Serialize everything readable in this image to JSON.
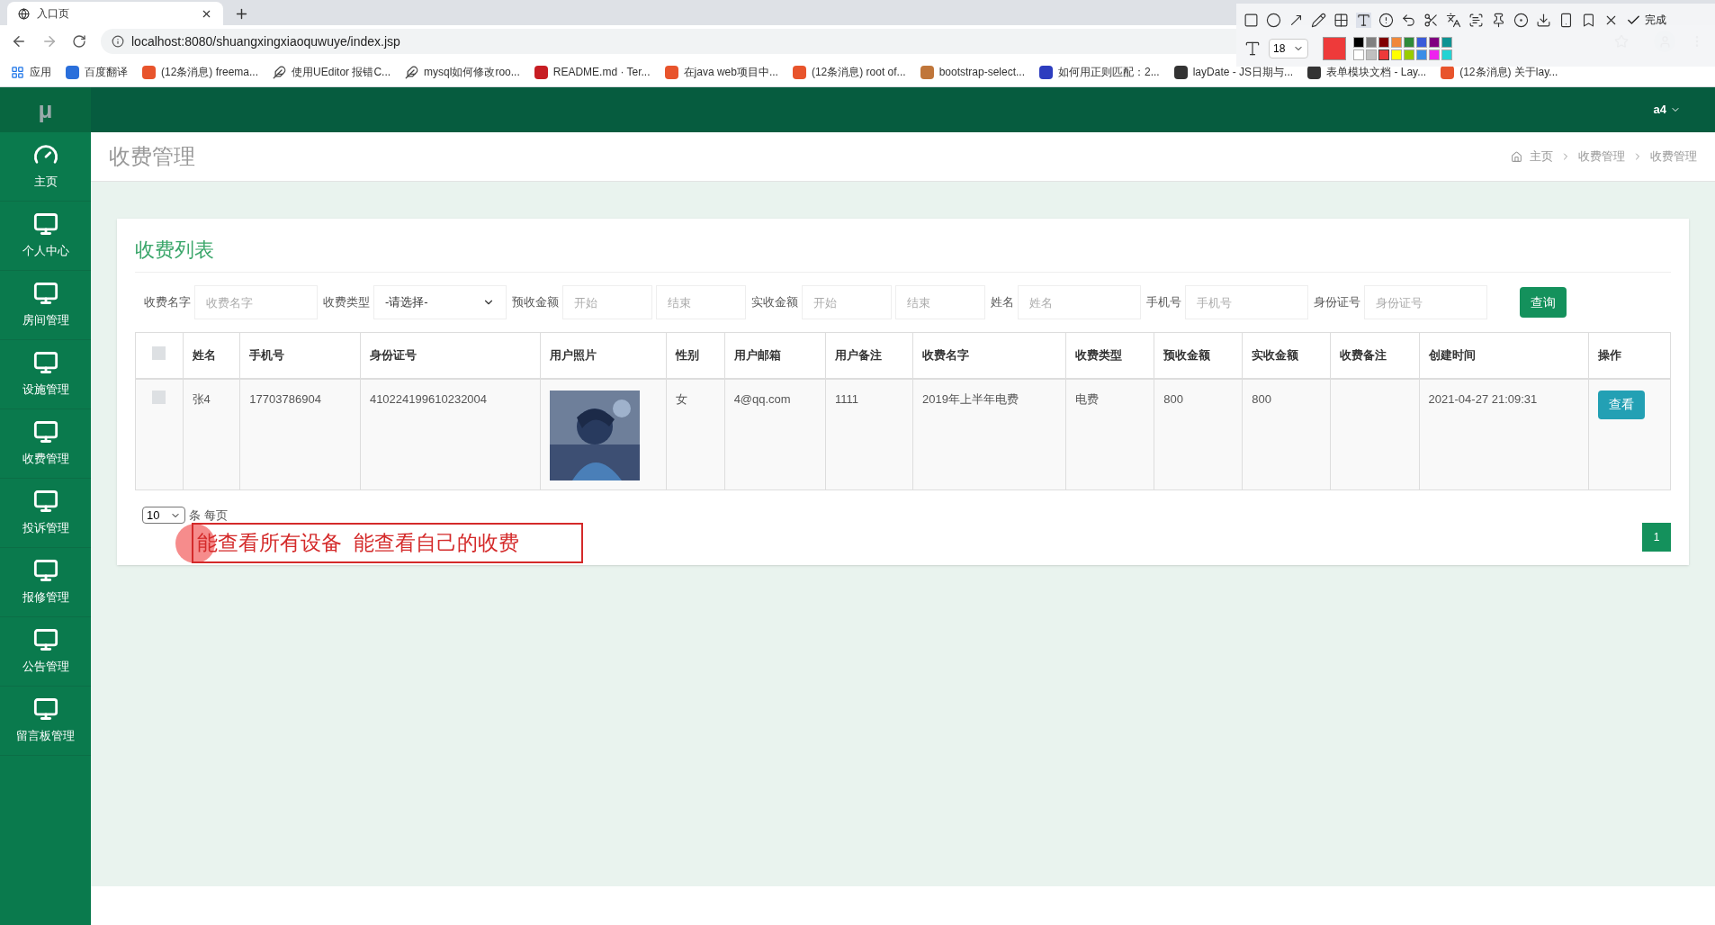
{
  "browser": {
    "tab": {
      "title": "入口页"
    },
    "url": "localhost:8080/shuangxingxiaoquwuye/index.jsp",
    "bookmarks": [
      {
        "label": "应用",
        "kind": "apps"
      },
      {
        "label": "百度翻译",
        "kind": "favicon",
        "color": "#2a6fdb"
      },
      {
        "label": "(12条消息) freema...",
        "kind": "favicon",
        "color": "#e8542c"
      },
      {
        "label": "使用UEditor 报错C...",
        "kind": "plain"
      },
      {
        "label": "mysql如何修改roo...",
        "kind": "plain"
      },
      {
        "label": "README.md · Ter...",
        "kind": "favicon",
        "color": "#c71d23"
      },
      {
        "label": "在java web项目中...",
        "kind": "favicon",
        "color": "#e8542c"
      },
      {
        "label": "(12条消息) root of...",
        "kind": "favicon",
        "color": "#e8542c"
      },
      {
        "label": "bootstrap-select...",
        "kind": "favicon",
        "color": "#c0763a"
      },
      {
        "label": "如何用正则匹配：2...",
        "kind": "favicon",
        "color": "#2d3dbf"
      },
      {
        "label": "layDate - JS日期与...",
        "kind": "favicon",
        "color": "#333333"
      },
      {
        "label": "表单模块文档 - Lay...",
        "kind": "favicon",
        "color": "#333333"
      },
      {
        "label": "(12条消息) 关于lay...",
        "kind": "favicon",
        "color": "#e8542c"
      }
    ]
  },
  "capture_toolbar": {
    "done": "完成",
    "font_size": "18",
    "palette": [
      {
        "color": "#000000",
        "selected": false
      },
      {
        "color": "#808080",
        "selected": false
      },
      {
        "color": "#800000",
        "selected": false
      },
      {
        "color": "#f0883a",
        "selected": false
      },
      {
        "color": "#2e8b3a",
        "selected": false
      },
      {
        "color": "#3a5bd9",
        "selected": false
      },
      {
        "color": "#800080",
        "selected": false
      },
      {
        "color": "#0e9393",
        "selected": false
      },
      {
        "color": "#ffffff",
        "selected": false
      },
      {
        "color": "#c0c0c0",
        "selected": false
      },
      {
        "color": "#ee3a3a",
        "selected": true
      },
      {
        "color": "#ffff00",
        "selected": false
      },
      {
        "color": "#99cc00",
        "selected": false
      },
      {
        "color": "#3a8ee6",
        "selected": false
      },
      {
        "color": "#ee22ee",
        "selected": false
      },
      {
        "color": "#22d3d3",
        "selected": false
      }
    ]
  },
  "app": {
    "logo": "μ",
    "user": "a4",
    "sidebar": [
      {
        "label": "主页",
        "kind": "dashboard"
      },
      {
        "label": "个人中心",
        "kind": "monitor"
      },
      {
        "label": "房间管理",
        "kind": "monitor"
      },
      {
        "label": "设施管理",
        "kind": "monitor"
      },
      {
        "label": "收费管理",
        "kind": "monitor"
      },
      {
        "label": "投诉管理",
        "kind": "monitor"
      },
      {
        "label": "报修管理",
        "kind": "monitor"
      },
      {
        "label": "公告管理",
        "kind": "monitor"
      },
      {
        "label": "留言板管理",
        "kind": "monitor"
      }
    ],
    "page_title": "收费管理",
    "breadcrumb": [
      "主页",
      "收费管理",
      "收费管理"
    ],
    "card": {
      "title": "收费列表",
      "filters": [
        {
          "label": "收费名字",
          "kind": "input",
          "fields": [
            {
              "placeholder": "收费名字"
            }
          ]
        },
        {
          "label": "收费类型",
          "kind": "select",
          "value": "-请选择-"
        },
        {
          "label": "预收金额",
          "kind": "input",
          "fields": [
            {
              "placeholder": "开始"
            },
            {
              "placeholder": "结束"
            }
          ]
        },
        {
          "label": "实收金额",
          "kind": "input",
          "fields": [
            {
              "placeholder": "开始"
            },
            {
              "placeholder": "结束"
            }
          ]
        },
        {
          "label": "姓名",
          "kind": "input",
          "fields": [
            {
              "placeholder": "姓名"
            }
          ]
        },
        {
          "label": "手机号",
          "kind": "input",
          "fields": [
            {
              "placeholder": "手机号"
            }
          ]
        },
        {
          "label": "身份证号",
          "kind": "input",
          "fields": [
            {
              "placeholder": "身份证号"
            }
          ]
        }
      ],
      "search_button": "查询",
      "table": {
        "columns": [
          "姓名",
          "手机号",
          "身份证号",
          "用户照片",
          "性别",
          "用户邮箱",
          "用户备注",
          "收费名字",
          "收费类型",
          "预收金额",
          "实收金额",
          "收费备注",
          "创建时间",
          "操作"
        ],
        "all_checked": false,
        "rows": [
          {
            "checked": false,
            "cells": [
              "张4",
              "17703786904",
              "410224199610232004",
              {
                "kind": "picture"
              },
              "女",
              "4@qq.com",
              "1111",
              "2019年上半年电费",
              "电费",
              "800",
              "800",
              "",
              "2021-04-27 21:09:31"
            ],
            "action": "查看"
          }
        ]
      },
      "page_size": "10",
      "page_size_label": "条 每页",
      "pages": [
        {
          "label": "1",
          "selected": true
        }
      ]
    },
    "annotation": "能查看所有设备  能查看自己的收费"
  }
}
